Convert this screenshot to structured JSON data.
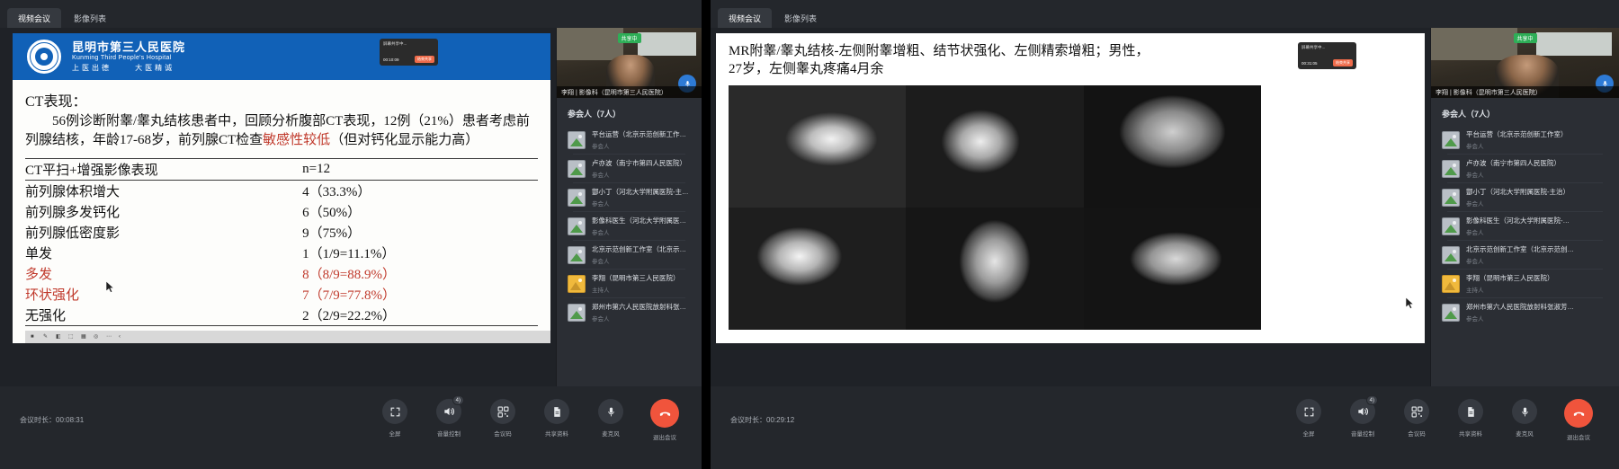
{
  "left_window": {
    "tabs": [
      {
        "label": "视频会议",
        "active": true
      },
      {
        "label": "影像列表",
        "active": false
      }
    ],
    "slide": {
      "hospital": {
        "name_cn": "昆明市第三人民医院",
        "name_en": "Kunming Third People's Hospital",
        "motto_left": "上医出德",
        "motto_right": "大医精诚"
      },
      "recording_badge": {
        "status": "屏幕共享中...",
        "time": "00:10:09",
        "button": "结束共享"
      },
      "title": "CT表现：",
      "paragraph_1": "56例诊断附睾/睾丸结核患者中，回顾分析腹部CT表现，12例（21%）患者考虑前列腺结核，年龄17-68岁，前列腺CT检查",
      "paragraph_highlight": "敏感性较低",
      "paragraph_2": "（但对钙化显示能力高）",
      "table": {
        "header": {
          "label": "CT平扫+增强影像表现",
          "value": "n=12"
        },
        "rows": [
          {
            "label": "前列腺体积增大",
            "value": "4（33.3%）",
            "red": false,
            "indent": false
          },
          {
            "label": "前列腺多发钙化",
            "value": "6（50%）",
            "red": false,
            "indent": false
          },
          {
            "label": "前列腺低密度影",
            "value": "9（75%）",
            "red": false,
            "indent": false
          },
          {
            "label": "单发",
            "value": "1（1/9=11.1%）",
            "red": false,
            "indent": true
          },
          {
            "label": "多发",
            "value": "8（8/9=88.9%）",
            "red": true,
            "indent": true
          },
          {
            "label": "环状强化",
            "value": "7（7/9=77.8%）",
            "red": true,
            "indent": true
          },
          {
            "label": "无强化",
            "value": "2（2/9=22.2%）",
            "red": false,
            "indent": true
          }
        ]
      },
      "toolbar_icons": [
        "stop-icon",
        "pen-icon",
        "eraser-icon",
        "select-icon",
        "grid-icon",
        "layers-icon",
        "more-icon",
        "collapse-icon"
      ]
    },
    "self_video": {
      "sharing_label": "共享中",
      "name": "李翔 | 影像科（昆明市第三人民医院）",
      "mic_icon": "microphone-icon"
    },
    "participants": {
      "title": "参会人（7人）",
      "items": [
        {
          "name": "平台运营（北京示范创新工作室）",
          "role": "参会人",
          "host": false
        },
        {
          "name": "卢亦波（南宁市第四人民医院）",
          "role": "参会人",
          "host": false
        },
        {
          "name": "酆小丁（河北大学附属医院-主治）",
          "role": "参会人",
          "host": false
        },
        {
          "name": "影像科医生（河北大学附属医院-…",
          "role": "参会人",
          "host": false
        },
        {
          "name": "北京示范创新工作室（北京示范创…",
          "role": "参会人",
          "host": false
        },
        {
          "name": "李翔（昆明市第三人民医院）",
          "role": "主持人",
          "host": true
        },
        {
          "name": "郑州市第六人民医院放射科张淑芳…",
          "role": "参会人",
          "host": false
        }
      ]
    },
    "bottom": {
      "duration_label": "会议时长：",
      "duration_value": "00:08:31",
      "controls": [
        {
          "label": "全屏",
          "icon": "fullscreen-icon",
          "badge": null,
          "danger": false
        },
        {
          "label": "音量控制",
          "icon": "speaker-icon",
          "badge": "4)",
          "danger": false
        },
        {
          "label": "会议码",
          "icon": "qrcode-icon",
          "badge": null,
          "danger": false
        },
        {
          "label": "共享资料",
          "icon": "document-icon",
          "badge": null,
          "danger": false
        },
        {
          "label": "麦克风",
          "icon": "microphone-icon",
          "badge": null,
          "danger": false
        },
        {
          "label": "退出会议",
          "icon": "hangup-icon",
          "badge": null,
          "danger": true
        }
      ]
    }
  },
  "right_window": {
    "tabs": [
      {
        "label": "视频会议",
        "active": true
      },
      {
        "label": "影像列表",
        "active": false
      }
    ],
    "slide": {
      "title_line_1": "MR附睾/睾丸结核-左侧附睾增粗、结节状强化、左侧精索增粗；男性，",
      "title_line_2": "27岁，左侧睾丸疼痛4月余",
      "recording_badge": {
        "status": "屏幕共享中...",
        "time": "00:31:05",
        "button": "结束共享"
      },
      "images": [
        {
          "name": "mri-axial-1"
        },
        {
          "name": "mri-axial-2"
        },
        {
          "name": "mri-axial-3"
        },
        {
          "name": "mri-coronal-1"
        },
        {
          "name": "mri-coronal-2"
        },
        {
          "name": "mri-coronal-3"
        }
      ]
    },
    "self_video": {
      "sharing_label": "共享中",
      "name": "李翔 | 影像科（昆明市第三人民医院）",
      "mic_icon": "microphone-icon"
    },
    "participants": {
      "title": "参会人（7人）",
      "items": [
        {
          "name": "平台运营（北京示范创新工作室）",
          "role": "参会人",
          "host": false
        },
        {
          "name": "卢亦波（南宁市第四人民医院）",
          "role": "参会人",
          "host": false
        },
        {
          "name": "酆小丁（河北大学附属医院-主治）",
          "role": "参会人",
          "host": false
        },
        {
          "name": "影像科医生（河北大学附属医院-…",
          "role": "参会人",
          "host": false
        },
        {
          "name": "北京示范创新工作室（北京示范创…",
          "role": "参会人",
          "host": false
        },
        {
          "name": "李翔（昆明市第三人民医院）",
          "role": "主持人",
          "host": true
        },
        {
          "name": "郑州市第六人民医院放射科张淑芳…",
          "role": "参会人",
          "host": false
        }
      ]
    },
    "bottom": {
      "duration_label": "会议时长：",
      "duration_value": "00:29:12",
      "controls": [
        {
          "label": "全屏",
          "icon": "fullscreen-icon",
          "badge": null,
          "danger": false
        },
        {
          "label": "音量控制",
          "icon": "speaker-icon",
          "badge": "4)",
          "danger": false
        },
        {
          "label": "会议码",
          "icon": "qrcode-icon",
          "badge": null,
          "danger": false
        },
        {
          "label": "共享资料",
          "icon": "document-icon",
          "badge": null,
          "danger": false
        },
        {
          "label": "麦克风",
          "icon": "microphone-icon",
          "badge": null,
          "danger": false
        },
        {
          "label": "退出会议",
          "icon": "hangup-icon",
          "badge": null,
          "danger": true
        }
      ]
    }
  },
  "colors": {
    "accent_blue": "#1161b7",
    "danger_red": "#f0543c",
    "highlight_red": "#c0392b",
    "share_green": "#2eae57",
    "panel_bg": "#2b2e34",
    "chrome_bg": "#24272c"
  }
}
